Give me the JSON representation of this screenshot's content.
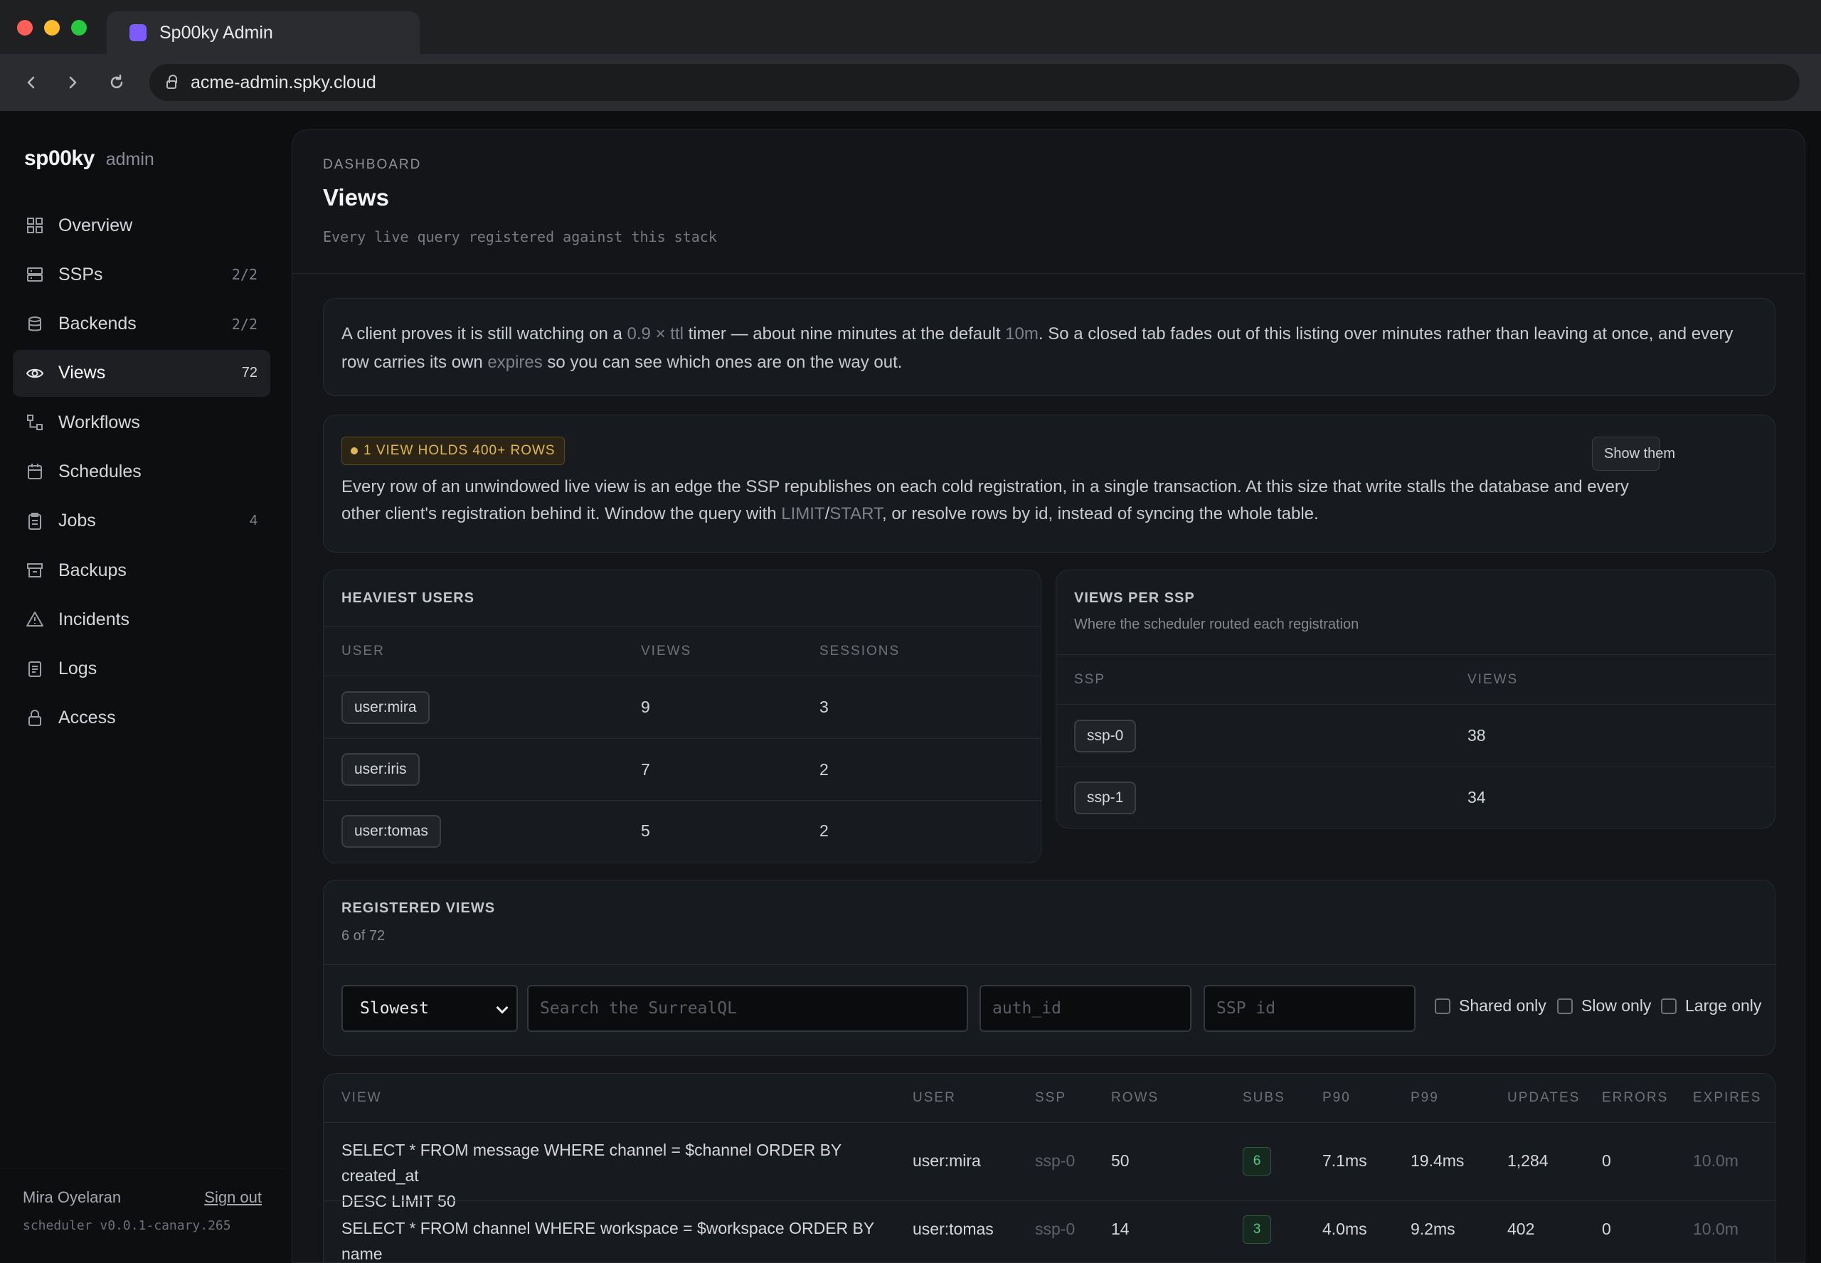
{
  "browser": {
    "tab_title": "Sp00ky Admin",
    "url": "acme-admin.spky.cloud"
  },
  "sidebar": {
    "brand": "sp00ky",
    "brand_sub": "admin",
    "items": [
      {
        "label": "Overview",
        "count": "",
        "icon": "grid-icon"
      },
      {
        "label": "SSPs",
        "count": "2/2",
        "icon": "server-icon"
      },
      {
        "label": "Backends",
        "count": "2/2",
        "icon": "database-icon"
      },
      {
        "label": "Views",
        "count": "72",
        "icon": "eye-icon",
        "active": true
      },
      {
        "label": "Workflows",
        "count": "",
        "icon": "workflow-icon"
      },
      {
        "label": "Schedules",
        "count": "",
        "icon": "calendar-icon"
      },
      {
        "label": "Jobs",
        "count": "4",
        "icon": "clipboard-icon"
      },
      {
        "label": "Backups",
        "count": "",
        "icon": "archive-icon"
      },
      {
        "label": "Incidents",
        "count": "",
        "icon": "warning-icon"
      },
      {
        "label": "Logs",
        "count": "",
        "icon": "document-icon"
      },
      {
        "label": "Access",
        "count": "",
        "icon": "lock-icon"
      }
    ],
    "user": "Mira Oyelaran",
    "sign_out": "Sign out",
    "version": "scheduler v0.0.1-canary.265"
  },
  "header": {
    "kicker": "DASHBOARD",
    "title": "Views",
    "subtitle": "Every live query registered against this stack"
  },
  "info": {
    "p1": "A client proves it is still watching on a ",
    "hl1": "0.9 × ttl",
    "p2": " timer — about nine minutes at the default ",
    "hl2": "10m",
    "p3": ". So a closed tab fades out of this listing over minutes rather than leaving at once, and every row carries its own ",
    "hl3": "expires",
    "p4": " so you can see which ones are on the way out."
  },
  "warning": {
    "badge": "1 VIEW HOLDS 400+ ROWS",
    "t1": "Every row of an unwindowed live view is an edge the SSP republishes on each cold registration, in a single transaction. At this size that write stalls the database and every other client's registration behind it. Window the query with ",
    "hl1": "LIMIT",
    "sep": "/",
    "hl2": "START",
    "t2": ", or resolve rows by id, instead of syncing the whole table.",
    "button": "Show them"
  },
  "heaviest_users": {
    "title": "HEAVIEST USERS",
    "columns": [
      "USER",
      "VIEWS",
      "SESSIONS"
    ],
    "rows": [
      {
        "user": "user:mira",
        "views": "9",
        "sessions": "3"
      },
      {
        "user": "user:iris",
        "views": "7",
        "sessions": "2"
      },
      {
        "user": "user:tomas",
        "views": "5",
        "sessions": "2"
      }
    ]
  },
  "views_per_ssp": {
    "title": "VIEWS PER SSP",
    "subtitle": "Where the scheduler routed each registration",
    "columns": [
      "SSP",
      "VIEWS"
    ],
    "rows": [
      {
        "ssp": "ssp-0",
        "views": "38"
      },
      {
        "ssp": "ssp-1",
        "views": "34"
      }
    ]
  },
  "registered": {
    "title": "REGISTERED VIEWS",
    "count": "6 of 72",
    "sort": "Slowest",
    "search_placeholder": "Search the SurrealQL",
    "auth_placeholder": "auth_id",
    "ssp_placeholder": "SSP id",
    "shared_only": "Shared only",
    "slow_only": "Slow only",
    "large_only": "Large only"
  },
  "views_table": {
    "columns": [
      "VIEW",
      "USER",
      "SSP",
      "ROWS",
      "SUBS",
      "P90",
      "P99",
      "UPDATES",
      "ERRORS",
      "EXPIRES"
    ],
    "rows": [
      {
        "view_l1": "SELECT * FROM message WHERE channel = $channel ORDER BY created_at",
        "view_l2": "DESC LIMIT 50",
        "user": "user:mira",
        "ssp": "ssp-0",
        "rows": "50",
        "subs": "6",
        "p90": "7.1ms",
        "p99": "19.4ms",
        "updates": "1,284",
        "errors": "0",
        "expires": "10.0m"
      },
      {
        "view_l1": "SELECT * FROM channel WHERE workspace = $workspace ORDER BY name",
        "view_l2": "",
        "user": "user:tomas",
        "ssp": "ssp-0",
        "rows": "14",
        "subs": "3",
        "p90": "4.0ms",
        "p99": "9.2ms",
        "updates": "402",
        "errors": "0",
        "expires": "10.0m"
      }
    ]
  },
  "colors": {
    "accent": "#7c5cff",
    "warning": "#e0b754",
    "success": "#55c98a"
  }
}
